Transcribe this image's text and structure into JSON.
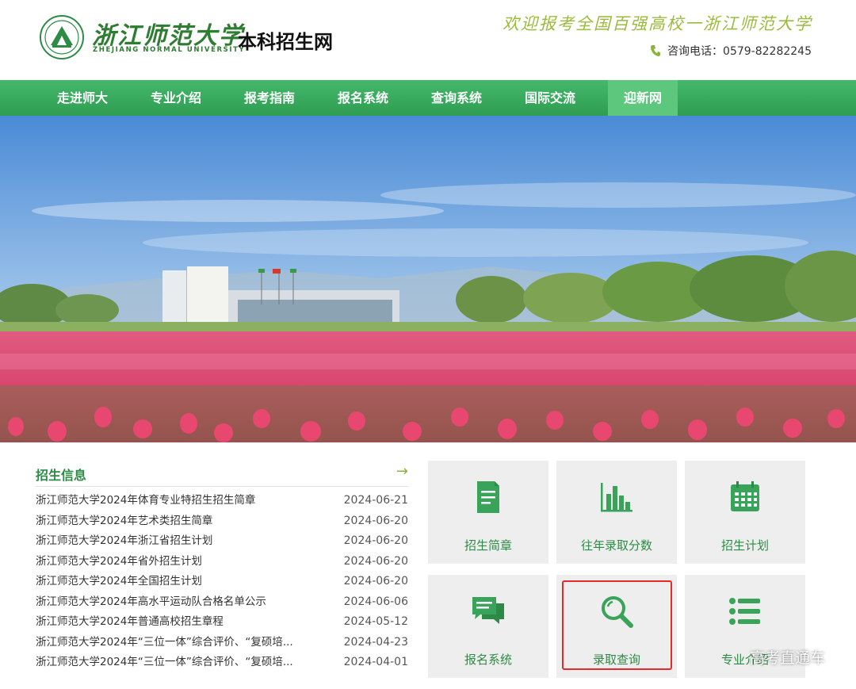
{
  "header": {
    "logo_cn": "浙江师范大学",
    "logo_en": "ZHEJIANG NORMAL UNIVERSITY",
    "site_title": "本科招生网",
    "slogan": "欢迎报考全国百强高校一浙江师范大学",
    "phone": "咨询电话：0579-82282245"
  },
  "nav": {
    "items": [
      {
        "label": "走进师大"
      },
      {
        "label": "专业介绍"
      },
      {
        "label": "报考指南"
      },
      {
        "label": "报名系统"
      },
      {
        "label": "查询系统"
      },
      {
        "label": "国际交流"
      },
      {
        "label": "迎新网"
      }
    ]
  },
  "news": {
    "title": "招生信息",
    "more": "→",
    "items": [
      {
        "text": "浙江师范大学2024年体育专业特招生招生简章",
        "date": "2024-06-21"
      },
      {
        "text": "浙江师范大学2024年艺术类招生简章",
        "date": "2024-06-20"
      },
      {
        "text": "浙江师范大学2024年浙江省招生计划",
        "date": "2024-06-20"
      },
      {
        "text": "浙江师范大学2024年省外招生计划",
        "date": "2024-06-20"
      },
      {
        "text": "浙江师范大学2024年全国招生计划",
        "date": "2024-06-20"
      },
      {
        "text": "浙江师范大学2024年高水平运动队合格名单公示",
        "date": "2024-06-06"
      },
      {
        "text": "浙江师范大学2024年普通高校招生章程",
        "date": "2024-05-12"
      },
      {
        "text": "浙江师范大学2024年“三位一体”综合评价、“复硕培...",
        "date": "2024-04-23"
      },
      {
        "text": "浙江师范大学2024年“三位一体”综合评价、“复硕培...",
        "date": "2024-04-01"
      }
    ]
  },
  "tiles": [
    {
      "label": "招生简章",
      "icon": "document-icon"
    },
    {
      "label": "往年录取分数",
      "icon": "bar-chart-icon"
    },
    {
      "label": "招生计划",
      "icon": "calendar-icon"
    },
    {
      "label": "报名系统",
      "icon": "chat-bubbles-icon"
    },
    {
      "label": "录取查询",
      "icon": "search-icon"
    },
    {
      "label": "专业介绍",
      "icon": "list-icon"
    }
  ],
  "watermark": "高考直通车",
  "colors": {
    "brand_green": "#2e8b46",
    "nav_green": "#3aab5e",
    "slogan": "#9bbb3c",
    "highlight": "#e32b2b"
  }
}
